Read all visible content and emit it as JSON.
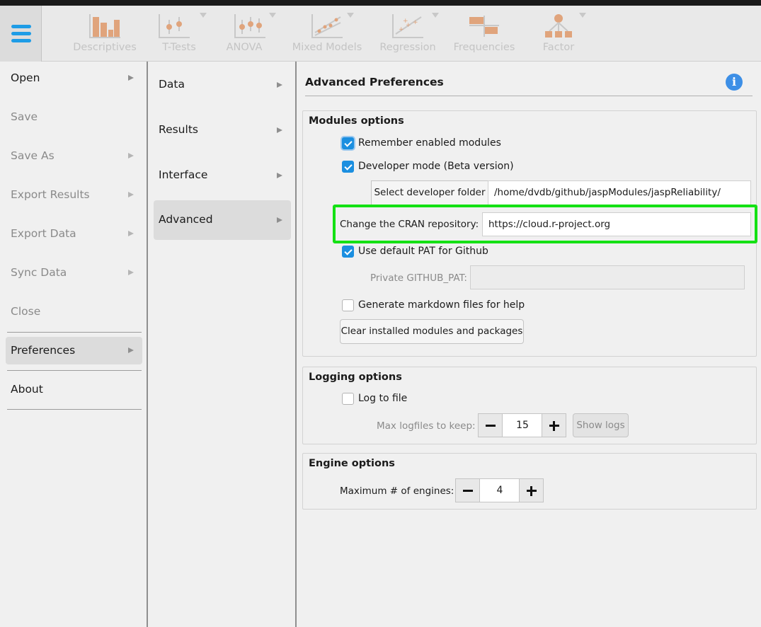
{
  "toolbar": {
    "menu_icon": "hamburger-menu-icon",
    "items": [
      {
        "label": "Descriptives",
        "icon": "bar-chart-icon"
      },
      {
        "label": "T-Tests",
        "icon": "ttest-icon"
      },
      {
        "label": "ANOVA",
        "icon": "anova-icon"
      },
      {
        "label": "Mixed Models",
        "icon": "mixed-models-icon"
      },
      {
        "label": "Regression",
        "icon": "regression-icon"
      },
      {
        "label": "Frequencies",
        "icon": "frequencies-icon"
      },
      {
        "label": "Factor",
        "icon": "factor-icon"
      }
    ]
  },
  "main_menu": {
    "items": [
      {
        "label": "Open"
      },
      {
        "label": "Save"
      },
      {
        "label": "Save As"
      },
      {
        "label": "Export Results"
      },
      {
        "label": "Export Data"
      },
      {
        "label": "Sync Data"
      },
      {
        "label": "Close"
      },
      {
        "label": "Preferences"
      },
      {
        "label": "About"
      }
    ]
  },
  "sub_menu": {
    "items": [
      {
        "label": "Data"
      },
      {
        "label": "Results"
      },
      {
        "label": "Interface"
      },
      {
        "label": "Advanced"
      }
    ]
  },
  "content": {
    "title": "Advanced Preferences",
    "info_icon": "i",
    "modules": {
      "title": "Modules options",
      "remember_label": "Remember enabled modules",
      "developer_label": "Developer mode (Beta version)",
      "dev_folder_button": "Select developer folder",
      "dev_folder_value": "/home/dvdb/github/jaspModules/jaspReliability/",
      "cran_label": "Change the CRAN repository:",
      "cran_value": "https://cloud.r-project.org",
      "pat_label": "Use default PAT for Github",
      "private_pat_label": "Private GITHUB_PAT:",
      "private_pat_value": "",
      "markdown_label": "Generate markdown files for help",
      "clear_button": "Clear installed modules and packages"
    },
    "logging": {
      "title": "Logging options",
      "log_to_file_label": "Log to file",
      "max_logfiles_label": "Max logfiles to keep:",
      "max_logfiles_value": "15",
      "show_logs_button": "Show logs"
    },
    "engine": {
      "title": "Engine options",
      "max_engines_label": "Maximum # of engines:",
      "max_engines_value": "4"
    }
  },
  "colors": {
    "accent": "#1b8fe0",
    "highlight": "#14e114"
  }
}
